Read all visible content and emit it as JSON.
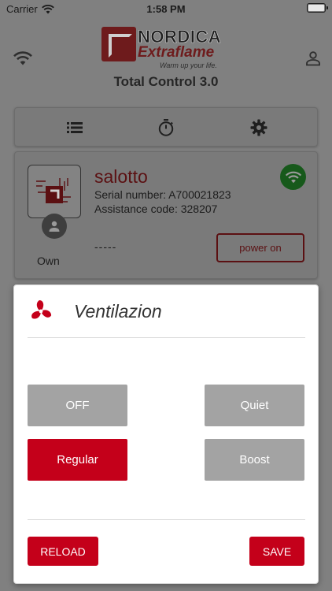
{
  "status_bar": {
    "carrier": "Carrier",
    "time": "1:58 PM"
  },
  "header": {
    "brand_line1": "NORDICA",
    "brand_line2": "Extraflame",
    "tagline": "Warm up your life.",
    "app_title": "Total Control 3.0"
  },
  "tabs": [
    "list-icon",
    "timer-icon",
    "settings-icon"
  ],
  "device": {
    "name": "salotto",
    "serial": "Serial number: A700021823",
    "assistance": "Assistance code: 328207",
    "role": "Own",
    "state": "-----",
    "power_button": "power on",
    "wifi_badge_color": "#17591b"
  },
  "modal": {
    "title": "Ventilazion",
    "options": [
      {
        "label": "OFF",
        "selected": false
      },
      {
        "label": "Quiet",
        "selected": false
      },
      {
        "label": "Regular",
        "selected": true
      },
      {
        "label": "Boost",
        "selected": false
      }
    ],
    "reload_label": "RELOAD",
    "save_label": "SAVE"
  },
  "colors": {
    "accent": "#c4001a",
    "unselected": "#a3a3a3",
    "brand_dark_red": "#6e1b1c"
  }
}
